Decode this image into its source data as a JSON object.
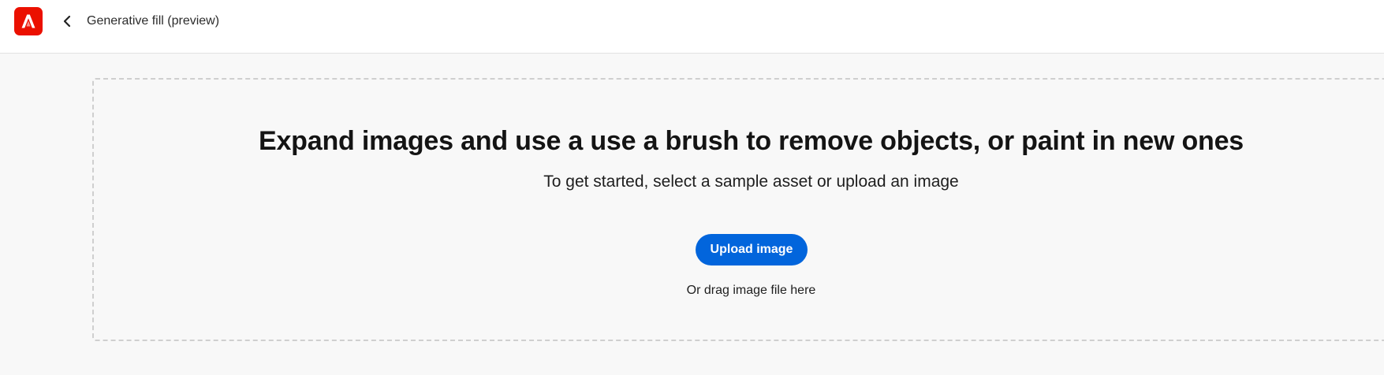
{
  "header": {
    "logo_icon": "adobe-express-logo-icon",
    "back_icon": "chevron-left-icon",
    "title": "Generative fill (preview)"
  },
  "dropzone": {
    "headline": "Expand images and use a use a brush to remove objects, or paint in new ones",
    "subheadline": "To get started, select a sample asset or upload an image",
    "upload_button_label": "Upload image",
    "drag_hint": "Or drag image file here"
  },
  "colors": {
    "brand_red": "#eb1000",
    "accent_blue": "#0265dc",
    "page_background": "#f8f8f8",
    "topbar_background": "#ffffff"
  }
}
